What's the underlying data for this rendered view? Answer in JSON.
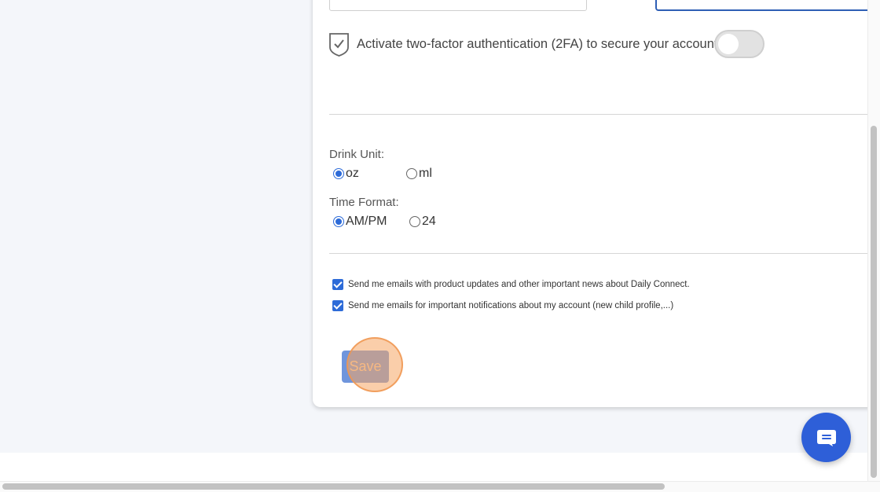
{
  "security": {
    "twofa_label": "Activate two-factor authentication (2FA) to secure your account.",
    "twofa_enabled": false
  },
  "units": {
    "drink_label": "Drink Unit:",
    "drink_options": [
      "oz",
      "ml"
    ],
    "drink_selected": "oz",
    "time_label": "Time Format:",
    "time_options": [
      "AM/PM",
      "24"
    ],
    "time_selected": "AM/PM"
  },
  "emails": [
    {
      "label": "Send me emails with product updates and other important news about Daily Connect.",
      "checked": true
    },
    {
      "label": "Send me emails for important notifications about my account (new child profile,...)",
      "checked": true
    }
  ],
  "actions": {
    "save_label": "Save"
  },
  "icons": {
    "shield": "shield-check-icon",
    "chat": "chat-bubble-icon"
  },
  "colors": {
    "accent": "#2d6bd8",
    "chat": "#2e5fd8",
    "save_button": "#6f95dc",
    "click_highlight": "#f5a564"
  }
}
